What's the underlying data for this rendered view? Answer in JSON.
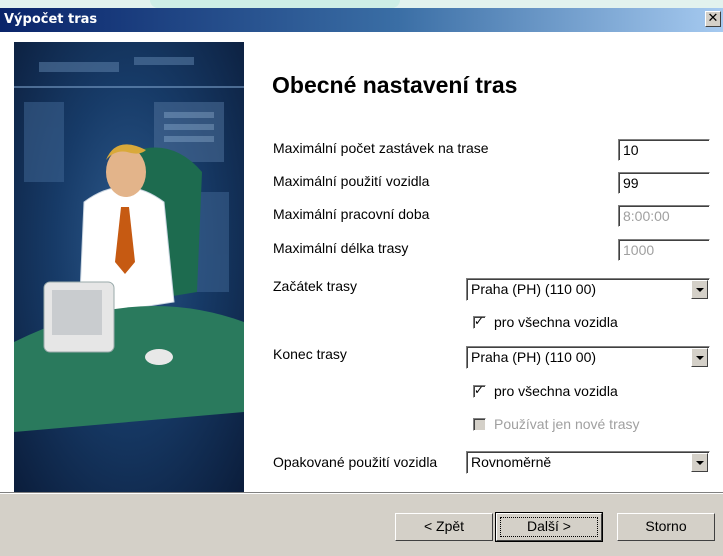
{
  "window": {
    "title": "Výpočet tras",
    "close_glyph": "✕"
  },
  "page": {
    "heading": "Obecné nastavení tras"
  },
  "fields": [
    {
      "label": "Maximální počet zastávek na trase",
      "value": "10",
      "enabled": true
    },
    {
      "label": "Maximální použití vozidla",
      "value": "99",
      "enabled": true
    },
    {
      "label": "Maximální pracovní doba",
      "value": "8:00:00",
      "enabled": false
    },
    {
      "label": "Maximální délka trasy",
      "value": "1000",
      "enabled": false
    }
  ],
  "start": {
    "label": "Začátek trasy",
    "selected": "Praha  (PH) (110 00)",
    "all_vehicles_label": "pro všechna vozidla",
    "all_vehicles_checked": true
  },
  "end": {
    "label": "Konec trasy",
    "selected": "Praha  (PH) (110 00)",
    "all_vehicles_label": "pro všechna vozidla",
    "all_vehicles_checked": true,
    "new_routes_label": "Používat jen nové trasy",
    "new_routes_checked": false
  },
  "reuse": {
    "label": "Opakované použití vozidla",
    "selected": "Rovnoměrně"
  },
  "buttons": {
    "back": "< Zpět",
    "next": "Další >",
    "cancel": "Storno"
  },
  "icons": {
    "checkmark": "✓",
    "close": "close-icon",
    "dropdown": "chevron-down-icon"
  },
  "colors": {
    "titlebar_start": "#0a246a",
    "titlebar_end": "#a6caf0",
    "panel": "#173b68",
    "face": "#d4d0c8"
  }
}
